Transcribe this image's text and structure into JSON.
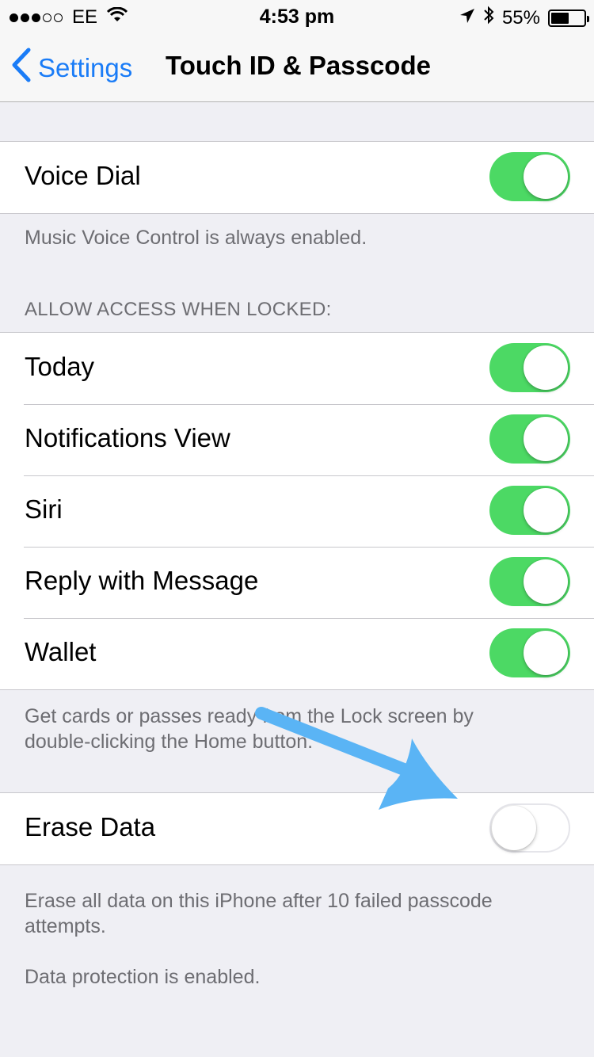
{
  "status_bar": {
    "carrier": "EE",
    "signal_bars_filled": 3,
    "signal_bars_total": 5,
    "time": "4:53 pm",
    "battery_percent": "55%",
    "battery_level": 0.55
  },
  "nav": {
    "back_label": "Settings",
    "title": "Touch ID & Passcode"
  },
  "voice_dial": {
    "label": "Voice Dial",
    "on": true,
    "footer": "Music Voice Control is always enabled."
  },
  "locked_section": {
    "header": "ALLOW ACCESS WHEN LOCKED:",
    "items": [
      {
        "label": "Today",
        "on": true
      },
      {
        "label": "Notifications View",
        "on": true
      },
      {
        "label": "Siri",
        "on": true
      },
      {
        "label": "Reply with Message",
        "on": true
      },
      {
        "label": "Wallet",
        "on": true
      }
    ],
    "footer_line1": "Get cards or passes ready from the Lock screen by",
    "footer_line2": "double-clicking the Home button."
  },
  "erase": {
    "label": "Erase Data",
    "on": false,
    "footer_line1": "Erase all data on this iPhone after 10 failed passcode",
    "footer_line2": "attempts.",
    "footer_protection": "Data protection is enabled."
  },
  "colors": {
    "accent": "#1a7cf7",
    "toggle_on": "#4cd964",
    "annotation_arrow": "#5ab4f5"
  }
}
